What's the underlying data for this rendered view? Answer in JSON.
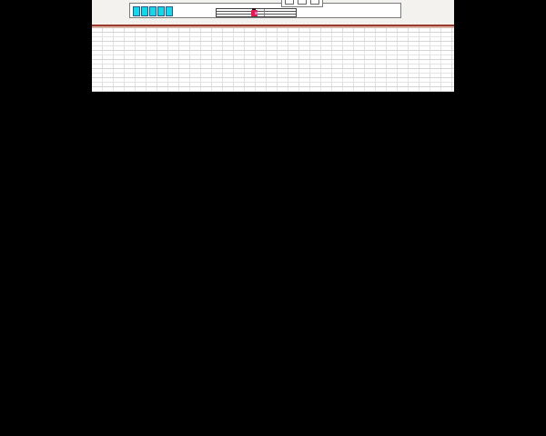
{
  "hud": {
    "energy_cells": [
      {
        "state": "full"
      },
      {
        "state": "full"
      },
      {
        "state": "full"
      },
      {
        "state": "full"
      },
      {
        "state": "full"
      }
    ],
    "energy_color": "#13d8ea",
    "player_marker_color": "#e0194f",
    "map_position_fraction": 0.47
  },
  "scene": {
    "floor_color": "#9b3a2c",
    "wall": "brick",
    "background_color": "#000000"
  },
  "icons": {
    "tab": [
      "tab-glyph-icon",
      "tab-glyph-icon",
      "tab-glyph-icon"
    ],
    "player": "player-marker-icon"
  }
}
